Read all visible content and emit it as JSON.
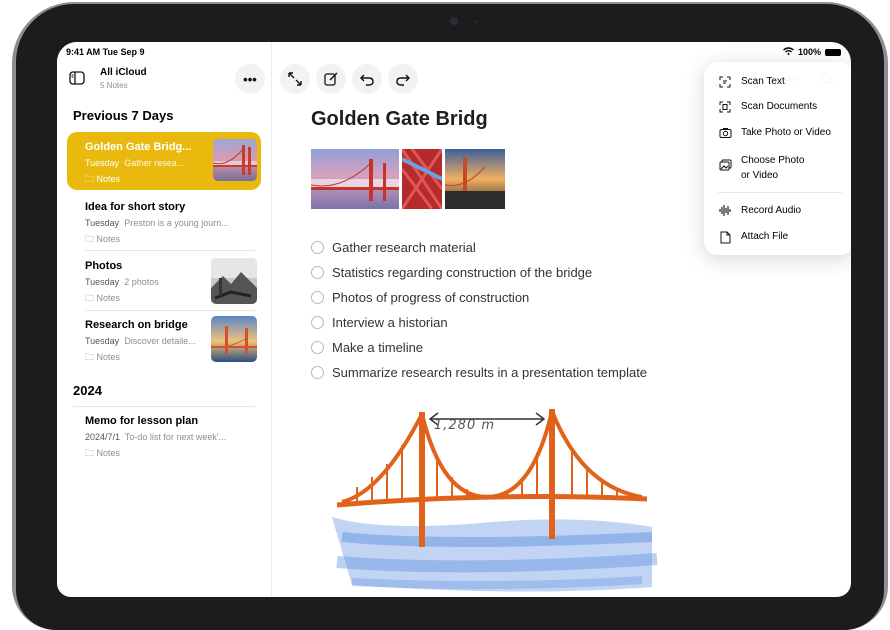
{
  "status": {
    "time": "9:41 AM  Tue Sep 9",
    "battery": "100%"
  },
  "sidebar": {
    "folder_title": "All iCloud",
    "folder_count": "5 Notes",
    "more_label": "•••",
    "sections": [
      {
        "title": "Previous 7 Days"
      },
      {
        "title": "2024"
      }
    ],
    "notes": [
      {
        "title": "Golden Gate Bridg...",
        "date": "Tuesday",
        "preview": "Gather resea...",
        "folder": "Notes"
      },
      {
        "title": "Idea for short story",
        "date": "Tuesday",
        "preview": "Preston is a young journ...",
        "folder": "Notes"
      },
      {
        "title": "Photos",
        "date": "Tuesday",
        "preview": "2 photos",
        "folder": "Notes"
      },
      {
        "title": "Research on bridge",
        "date": "Tuesday",
        "preview": "Discover detaile...",
        "folder": "Notes"
      },
      {
        "title": "Memo for lesson plan",
        "date": "2024/7/1",
        "preview": "To-do list for next week'...",
        "folder": "Notes"
      }
    ]
  },
  "toolbar": {
    "expand_icon": "expand-arrows-icon",
    "compose_icon": "compose-icon",
    "undo_icon": "undo-icon",
    "redo_icon": "redo-icon",
    "markup_icon": "markup-pen-icon",
    "share_icon": "share-icon",
    "more_label": "•••",
    "search_icon": "search-icon"
  },
  "attach_menu": {
    "items": [
      {
        "label": "Scan Text",
        "icon": "scan-text-icon"
      },
      {
        "label": "Scan Documents",
        "icon": "scan-documents-icon"
      },
      {
        "label": "Take Photo or Video",
        "icon": "camera-icon"
      },
      {
        "label_line1": "Choose Photo",
        "label_line2": "or Video",
        "icon": "photo-library-icon"
      },
      {
        "label": "Record Audio",
        "icon": "waveform-icon"
      },
      {
        "label": "Attach File",
        "icon": "document-icon"
      }
    ]
  },
  "note": {
    "title": "Golden Gate Bridg",
    "checklist": [
      "Gather research material",
      "Statistics regarding construction of the bridge",
      "Photos of progress of construction",
      "Interview a historian",
      "Make a timeline",
      "Summarize research results in a presentation template"
    ],
    "sketch_label": "1,280 m"
  },
  "colors": {
    "accent": "#e9b90e",
    "sketch_orange": "#e0621b",
    "sketch_water": "#5b8fe0"
  }
}
